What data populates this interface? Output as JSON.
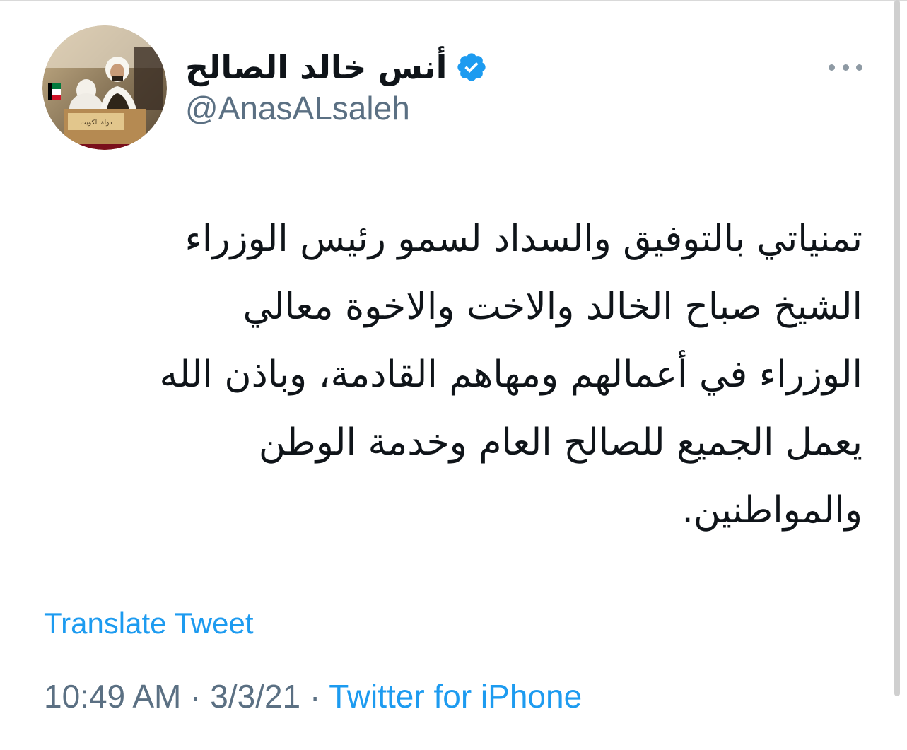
{
  "tweet": {
    "author": {
      "display_name": "أنس خالد الصالح",
      "handle": "@AnasALsaleh",
      "verified_icon": "verified-badge-icon",
      "avatar_caption": "دولة الكويت"
    },
    "more_icon": "more-dots-icon",
    "text_lines": [
      "تمنياتي بالتوفيق والسداد لسمو رئيس الوزراء",
      "الشيخ صباح الخالد والاخت والاخوة معالي",
      "الوزراء في أعمالهم ومهاهم القادمة، وباذن الله",
      "يعمل الجميع للصالح العام وخدمة الوطن",
      "والمواطنين."
    ],
    "translate_label": "Translate Tweet",
    "time": "10:49 AM",
    "separator": "·",
    "date": "3/3/21",
    "source": "Twitter for iPhone"
  },
  "colors": {
    "accent": "#1d9bf0",
    "secondary_text": "#5b7083",
    "primary_text": "#0f1419"
  }
}
